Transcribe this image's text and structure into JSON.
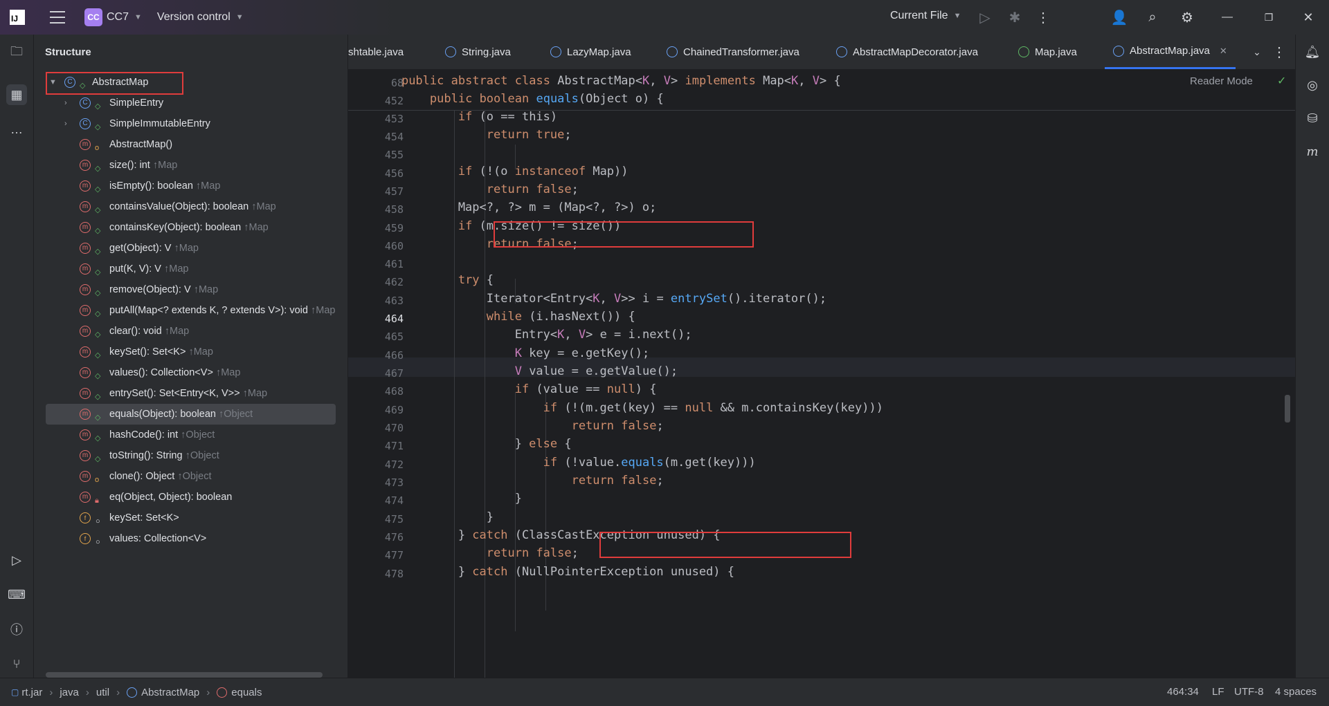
{
  "titlebar": {
    "logo_text": "IJ",
    "project_badge": "CC",
    "project_name": "CC7",
    "vcs_label": "Version control",
    "run_config": "Current File"
  },
  "structure": {
    "title": "Structure",
    "items": [
      {
        "label": "AbstractMap",
        "suffix": ""
      },
      {
        "label": "SimpleEntry",
        "suffix": ""
      },
      {
        "label": "SimpleImmutableEntry",
        "suffix": ""
      },
      {
        "label": "AbstractMap()",
        "suffix": ""
      },
      {
        "label": "size(): int",
        "suffix": "↑Map"
      },
      {
        "label": "isEmpty(): boolean",
        "suffix": "↑Map"
      },
      {
        "label": "containsValue(Object): boolean",
        "suffix": "↑Map"
      },
      {
        "label": "containsKey(Object): boolean",
        "suffix": "↑Map"
      },
      {
        "label": "get(Object): V",
        "suffix": "↑Map"
      },
      {
        "label": "put(K, V): V",
        "suffix": "↑Map"
      },
      {
        "label": "remove(Object): V",
        "suffix": "↑Map"
      },
      {
        "label": "putAll(Map<? extends K, ? extends V>): void",
        "suffix": "↑Map"
      },
      {
        "label": "clear(): void",
        "suffix": "↑Map"
      },
      {
        "label": "keySet(): Set<K>",
        "suffix": "↑Map"
      },
      {
        "label": "values(): Collection<V>",
        "suffix": "↑Map"
      },
      {
        "label": "entrySet(): Set<Entry<K, V>>",
        "suffix": "↑Map"
      },
      {
        "label": "equals(Object): boolean",
        "suffix": "↑Object"
      },
      {
        "label": "hashCode(): int",
        "suffix": "↑Object"
      },
      {
        "label": "toString(): String",
        "suffix": "↑Object"
      },
      {
        "label": "clone(): Object",
        "suffix": "↑Object"
      },
      {
        "label": "eq(Object, Object): boolean",
        "suffix": ""
      },
      {
        "label": "keySet: Set<K>",
        "suffix": ""
      },
      {
        "label": "values: Collection<V>",
        "suffix": ""
      }
    ]
  },
  "tabs": [
    "shtable.java",
    "String.java",
    "LazyMap.java",
    "ChainedTransformer.java",
    "AbstractMapDecorator.java",
    "Map.java",
    "AbstractMap.java"
  ],
  "editor": {
    "reader_mode": "Reader Mode",
    "lines": [
      {
        "n": "68",
        "t": "    public abstract class AbstractMap<K, V> implements Map<K, V> {"
      },
      {
        "n": "452",
        "t": "        public boolean equals(Object o) {"
      },
      {
        "n": "453",
        "t": "            if (o == this)"
      },
      {
        "n": "454",
        "t": "                return true;"
      },
      {
        "n": "455",
        "t": ""
      },
      {
        "n": "456",
        "t": "            if (!(o instanceof Map))"
      },
      {
        "n": "457",
        "t": "                return false;"
      },
      {
        "n": "458",
        "t": "            Map<?, ?> m = (Map<?, ?>) o;"
      },
      {
        "n": "459",
        "t": "            if (m.size() != size())"
      },
      {
        "n": "460",
        "t": "                return false;"
      },
      {
        "n": "461",
        "t": ""
      },
      {
        "n": "462",
        "t": "            try {"
      },
      {
        "n": "463",
        "t": "                Iterator<Entry<K, V>> i = entrySet().iterator();"
      },
      {
        "n": "464",
        "t": "                while (i.hasNext()) {"
      },
      {
        "n": "465",
        "t": "                    Entry<K, V> e = i.next();"
      },
      {
        "n": "466",
        "t": "                    K key = e.getKey();"
      },
      {
        "n": "467",
        "t": "                    V value = e.getValue();"
      },
      {
        "n": "468",
        "t": "                    if (value == null) {"
      },
      {
        "n": "469",
        "t": "                        if (!(m.get(key) == null && m.containsKey(key)))"
      },
      {
        "n": "470",
        "t": "                            return false;"
      },
      {
        "n": "471",
        "t": "                    } else {"
      },
      {
        "n": "472",
        "t": "                        if (!value.equals(m.get(key)))"
      },
      {
        "n": "473",
        "t": "                            return false;"
      },
      {
        "n": "474",
        "t": "                    }"
      },
      {
        "n": "475",
        "t": "                }"
      },
      {
        "n": "476",
        "t": "            } catch (ClassCastException unused) {"
      },
      {
        "n": "477",
        "t": "                return false;"
      },
      {
        "n": "478",
        "t": "            } catch (NullPointerException unused) {"
      }
    ]
  },
  "statusbar": {
    "crumbs": [
      "rt.jar",
      "java",
      "util",
      "AbstractMap",
      "equals"
    ],
    "position": "464:34",
    "line_sep": "LF",
    "encoding": "UTF-8",
    "indent": "4 spaces"
  }
}
